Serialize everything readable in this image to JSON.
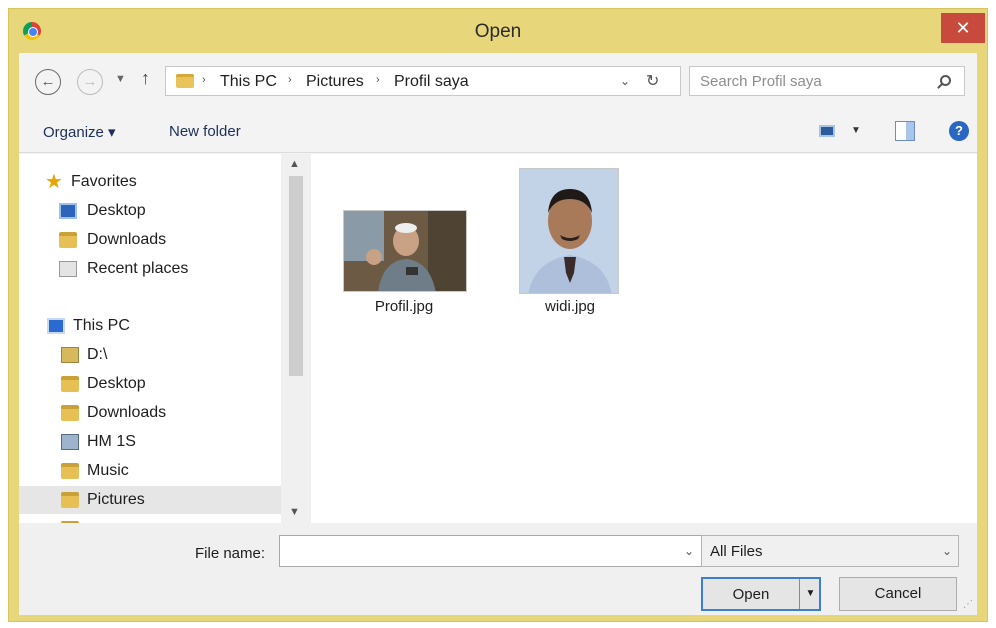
{
  "window": {
    "title": "Open",
    "close_label": "✕"
  },
  "address": {
    "breadcrumbs": [
      "This PC",
      "Profil saya"
    ],
    "breadcrumb_middle": "Pictures",
    "separator": "›",
    "search_placeholder": "Search Profil saya"
  },
  "toolbar": {
    "organize_label": "Organize ▾",
    "new_folder_label": "New folder",
    "help_label": "?"
  },
  "nav": {
    "favorites_label": "Favorites",
    "favorites_items": [
      "Desktop",
      "Downloads",
      "Recent places"
    ],
    "this_pc_label": "This PC",
    "this_pc_items": [
      "D:\\",
      "Desktop",
      "Downloads",
      "HM 1S",
      "Music",
      "Pictures"
    ],
    "selected": "Pictures"
  },
  "files": [
    {
      "name": "Profil.jpg"
    },
    {
      "name": "widi.jpg"
    }
  ],
  "bottom": {
    "file_name_label": "File name:",
    "file_name_value": "",
    "file_type_value": "All Files",
    "open_label": "Open",
    "cancel_label": "Cancel"
  },
  "colors": {
    "frame": "#e8d77a",
    "close": "#c74a3c",
    "accent": "#3c7fd0"
  }
}
